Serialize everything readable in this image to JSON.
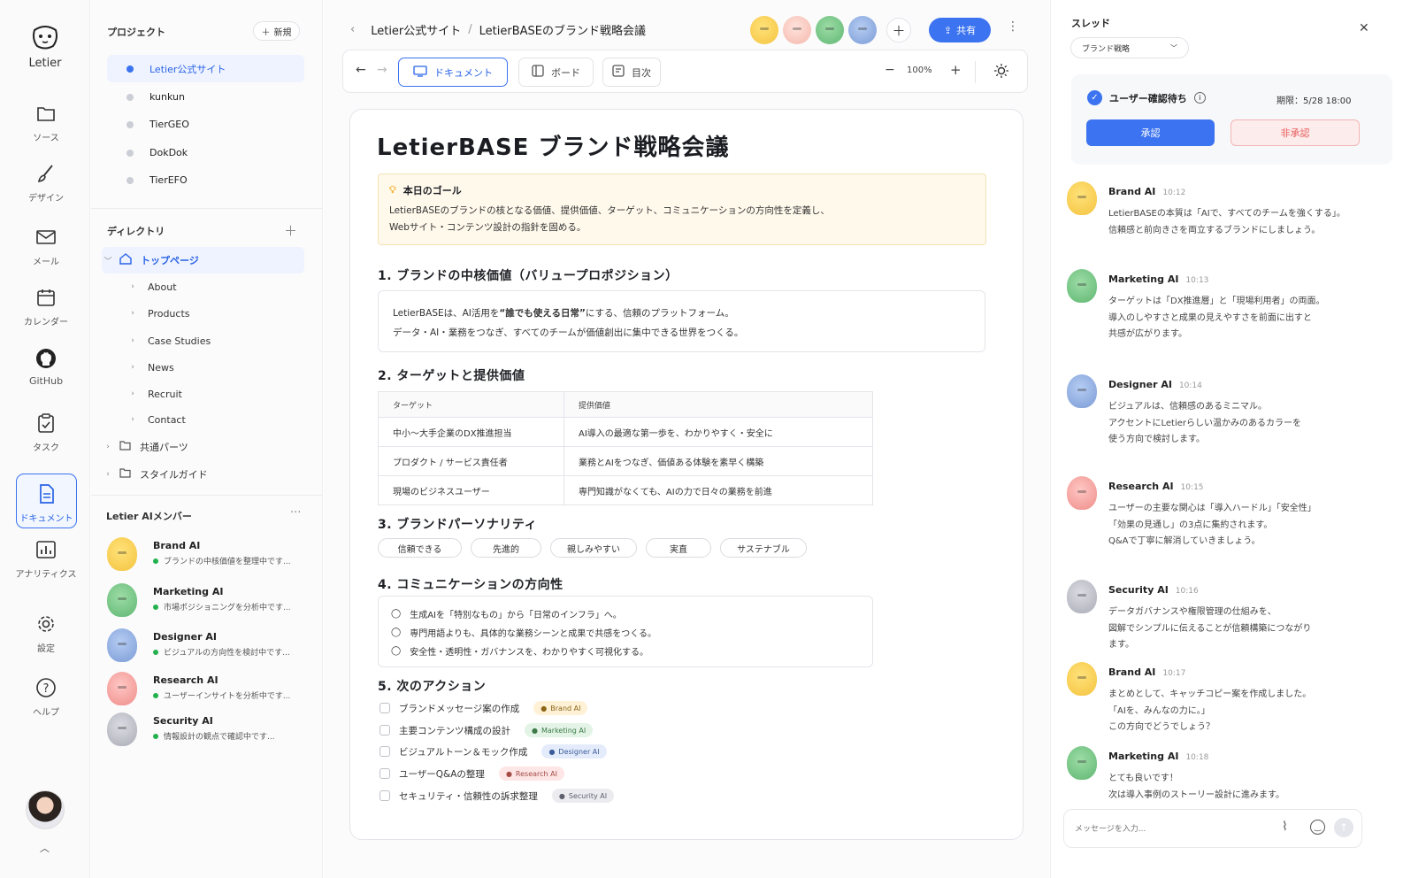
{
  "rail": {
    "logo_label": "Letier",
    "items": [
      {
        "label": "ソース",
        "icon": "folder-icon"
      },
      {
        "label": "デザイン",
        "icon": "brush-icon"
      },
      {
        "label": "メール",
        "icon": "mail-icon"
      },
      {
        "label": "カレンダー",
        "icon": "calendar-icon"
      },
      {
        "label": "GitHub",
        "icon": "github-icon"
      },
      {
        "label": "タスク",
        "icon": "clipboard-icon"
      },
      {
        "label": "ドキュメント",
        "icon": "document-icon"
      },
      {
        "label": "アナリティクス",
        "icon": "chart-icon"
      },
      {
        "label": "設定",
        "icon": "gear-icon"
      },
      {
        "label": "ヘルプ",
        "icon": "help-icon"
      }
    ]
  },
  "sidebar": {
    "projects_heading": "プロジェクト",
    "new_label": "新規",
    "projects": [
      "Letier公式サイト",
      "kunkun",
      "TierGEO",
      "DokDok",
      "TierEFO"
    ],
    "directory_heading": "ディレクトリ",
    "directory": [
      {
        "label": "トップページ"
      },
      {
        "label": "About"
      },
      {
        "label": "Products"
      },
      {
        "label": "Case Studies"
      },
      {
        "label": "News"
      },
      {
        "label": "Recruit"
      },
      {
        "label": "Contact"
      },
      {
        "label": "共通パーツ"
      },
      {
        "label": "スタイルガイド"
      }
    ],
    "members_heading": "Letier AIメンバー",
    "members": [
      {
        "name": "Brand AI",
        "status": "ブランドの中核価値を整理中です..."
      },
      {
        "name": "Marketing AI",
        "status": "市場ポジショニングを分析中です..."
      },
      {
        "name": "Designer AI",
        "status": "ビジュアルの方向性を検討中です..."
      },
      {
        "name": "Research AI",
        "status": "ユーザーインサイトを分析中です..."
      },
      {
        "name": "Security AI",
        "status": "情報設計の観点で確認中です..."
      }
    ]
  },
  "header": {
    "breadcrumb_root": "Letier公式サイト",
    "breadcrumb_sep": "/",
    "breadcrumb_current": "LetierBASEのブランド戦略会議",
    "share_label": "共有"
  },
  "toolbar": {
    "doc_label": "ドキュメント",
    "board_label": "ボード",
    "toc_label": "目次",
    "zoom": "100%"
  },
  "doc": {
    "title": "LetierBASE ブランド戦略会議",
    "goal_title": "本日のゴール",
    "goal_line1": "LetierBASEのブランドの核となる価値、提供価値、ターゲット、コミュニケーションの方向性を定義し、",
    "goal_line2": "Webサイト・コンテンツ設計の指針を固める。",
    "s1": "1. ブランドの中核価値（バリュープロポジション）",
    "s1_pre": "LetierBASEは、AI活用を",
    "s1_bold": "“誰でも使える日常”",
    "s1_post": "にする、信頼のプラットフォーム。",
    "s1_line2": "データ・AI・業務をつなぎ、すべてのチームが価値創出に集中できる世界をつくる。",
    "s2": "2. ターゲットと提供価値",
    "table_head": [
      "ターゲット",
      "提供価値"
    ],
    "table_rows": [
      [
        "中小〜大手企業のDX推進担当",
        "AI導入の最適な第一歩を、わかりやすく・安全に"
      ],
      [
        "プロダクト / サービス責任者",
        "業務とAIをつなぎ、価値ある体験を素早く構築"
      ],
      [
        "現場のビジネスユーザー",
        "専門知識がなくても、AIの力で日々の業務を前進"
      ]
    ],
    "s3": "3. ブランドパーソナリティ",
    "personality": [
      "信頼できる",
      "先進的",
      "親しみやすい",
      "実直",
      "サステナブル"
    ],
    "s4": "4. コミュニケーションの方向性",
    "comms": [
      "生成AIを「特別なもの」から「日常のインフラ」へ。",
      "専門用語よりも、具体的な業務シーンと成果で共感をつくる。",
      "安全性・透明性・ガバナンスを、わかりやすく可視化する。"
    ],
    "s5": "5. 次のアクション",
    "actions": [
      {
        "label": "ブランドメッセージ案の作成",
        "tag": "Brand AI"
      },
      {
        "label": "主要コンテンツ構成の設計",
        "tag": "Marketing AI"
      },
      {
        "label": "ビジュアルトーン＆モック作成",
        "tag": "Designer AI"
      },
      {
        "label": "ユーザーQ&Aの整理",
        "tag": "Research AI"
      },
      {
        "label": "セキュリティ・信頼性の訴求整理",
        "tag": "Security AI"
      }
    ]
  },
  "thread": {
    "heading": "スレッド",
    "filter": "ブランド戦略",
    "approval_label": "ユーザー確認待ち",
    "deadline": "期限：5/28 18:00",
    "approve": "承認",
    "reject": "非承認",
    "messages": [
      {
        "name": "Brand AI",
        "time": "10:12",
        "text": "LetierBASEの本質は「AIで、すべてのチームを強くする」。\n信頼感と前向きさを両立するブランドにしましょう。"
      },
      {
        "name": "Marketing AI",
        "time": "10:13",
        "text": "ターゲットは「DX推進層」と「現場利用者」の両面。\n導入のしやすさと成果の見えやすさを前面に出すと\n共感が広がります。"
      },
      {
        "name": "Designer AI",
        "time": "10:14",
        "text": "ビジュアルは、信頼感のあるミニマル。\nアクセントにLetierらしい温かみのあるカラーを\n使う方向で検討します。"
      },
      {
        "name": "Research AI",
        "time": "10:15",
        "text": "ユーザーの主要な関心は「導入ハードル」「安全性」\n「効果の見通し」の3点に集約されます。\nQ&Aで丁寧に解消していきましょう。"
      },
      {
        "name": "Security AI",
        "time": "10:16",
        "text": "データガバナンスや権限管理の仕組みを、\n図解でシンプルに伝えることが信頼構築につながり\nます。"
      },
      {
        "name": "Brand AI",
        "time": "10:17",
        "text": "まとめとして、キャッチコピー案を作成しました。\n「AIを、みんなの力に。」\nこの方向でどうでしょう？"
      },
      {
        "name": "Marketing AI",
        "time": "10:18",
        "text": "とても良いです！\n次は導入事例のストーリー設計に進みます。"
      }
    ],
    "input_placeholder": "メッセージを入力..."
  },
  "colors": {
    "accent": "#3b73f0",
    "reject": "#e65a5a",
    "goal_bg": "#fff9ec"
  }
}
